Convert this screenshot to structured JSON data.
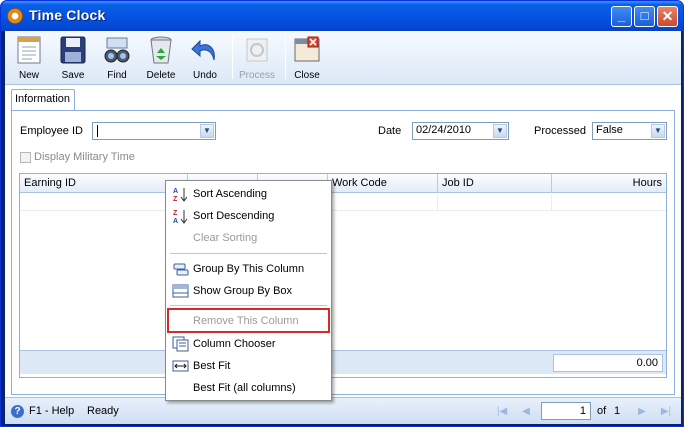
{
  "window": {
    "title": "Time Clock",
    "buttons": {
      "minimize": "_",
      "maximize": "□",
      "close": "✕"
    }
  },
  "toolbar": {
    "new": "New",
    "save": "Save",
    "find": "Find",
    "delete": "Delete",
    "undo": "Undo",
    "process": "Process",
    "close": "Close"
  },
  "tabs": [
    {
      "label": "Information"
    }
  ],
  "form": {
    "employee_id_label": "Employee ID",
    "employee_id_value": "",
    "date_label": "Date",
    "date_value": "02/24/2010",
    "processed_label": "Processed",
    "processed_value": "False",
    "military_time_label": "Display Military Time"
  },
  "grid": {
    "columns": [
      "Earning ID",
      "",
      "",
      "Work Code",
      "Job ID",
      "Hours"
    ],
    "total_hours": "0.00"
  },
  "context_menu": {
    "items": [
      {
        "label": "Sort Ascending",
        "icon": "sort-ascending-icon",
        "enabled": true
      },
      {
        "label": "Sort Descending",
        "icon": "sort-descending-icon",
        "enabled": true
      },
      {
        "label": "Clear Sorting",
        "icon": "",
        "enabled": false
      },
      {
        "label": "Group By This Column",
        "icon": "group-by-column-icon",
        "enabled": true
      },
      {
        "label": "Show Group By Box",
        "icon": "group-by-box-icon",
        "enabled": true
      },
      {
        "label": "Remove This Column",
        "icon": "",
        "enabled": false
      },
      {
        "label": "Column Chooser",
        "icon": "column-chooser-icon",
        "enabled": true
      },
      {
        "label": "Best Fit",
        "icon": "best-fit-icon",
        "enabled": true
      },
      {
        "label": "Best Fit (all columns)",
        "icon": "",
        "enabled": true
      }
    ]
  },
  "statusbar": {
    "help": "F1 - Help",
    "status": "Ready",
    "page_value": "1",
    "page_of": "of",
    "page_total": "1"
  },
  "colors": {
    "title_bar": "#0554e3",
    "highlight_border": "#d42a2a",
    "panel_border": "#8fb0dc"
  }
}
